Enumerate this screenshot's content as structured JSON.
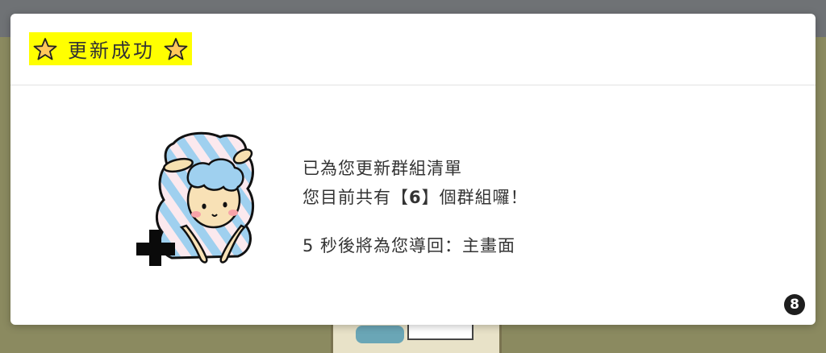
{
  "modal": {
    "title": "更新成功",
    "title_icon": "star-icon"
  },
  "message": {
    "line1": "已為您更新群組清單",
    "line2_prefix": "您目前共有【",
    "group_count": "6",
    "line2_suffix": "】個群組囉！",
    "redirect": "5 秒後將為您導回：主畫面"
  },
  "illustration": {
    "name": "sheep-with-plus-icon"
  },
  "badge": {
    "value": "8"
  },
  "colors": {
    "title_highlight": "#ffff00",
    "star_fill": "#ffc85a",
    "overlay": "#8b8a60"
  }
}
